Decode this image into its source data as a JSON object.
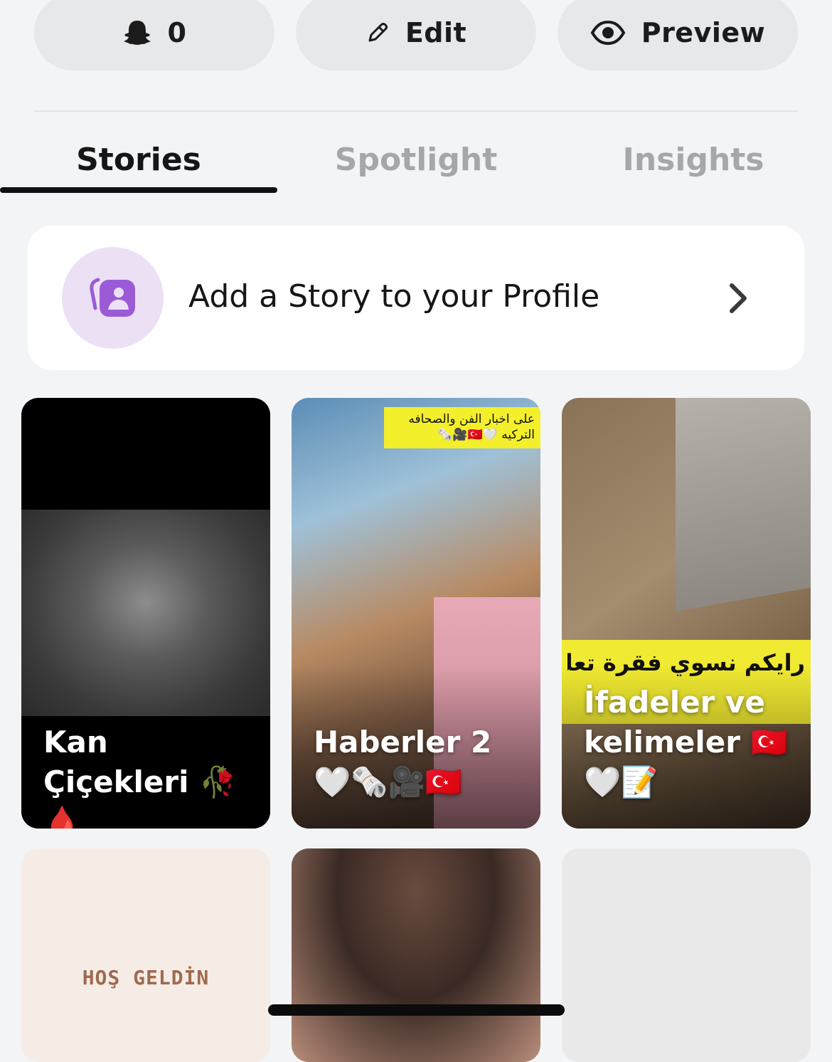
{
  "actions": {
    "friends_count": "0",
    "edit_label": "Edit",
    "preview_label": "Preview"
  },
  "tabs": [
    {
      "label": "Stories",
      "active": true
    },
    {
      "label": "Spotlight",
      "active": false
    },
    {
      "label": "Insights",
      "active": false
    }
  ],
  "add_story": {
    "label": "Add a Story to your Profile",
    "accent": "#9b5bd6"
  },
  "stories": [
    {
      "title": "Kan Çiçekleri 🥀🩸"
    },
    {
      "title": "Haberler 2 🤍🗞️🎥🇹🇷",
      "banner": "على اخبار الفن والصحافه التركيه 🤍🇹🇷🎥🗞️"
    },
    {
      "title": "İfadeler ve kelimeler 🇹🇷🤍📝",
      "overlay": "رايكم نسوي فقرة تعلم في اللغة التركية"
    },
    {
      "title": "",
      "overlay": "HOŞ GELDİN"
    },
    {
      "title": ""
    },
    {
      "title": ""
    }
  ]
}
